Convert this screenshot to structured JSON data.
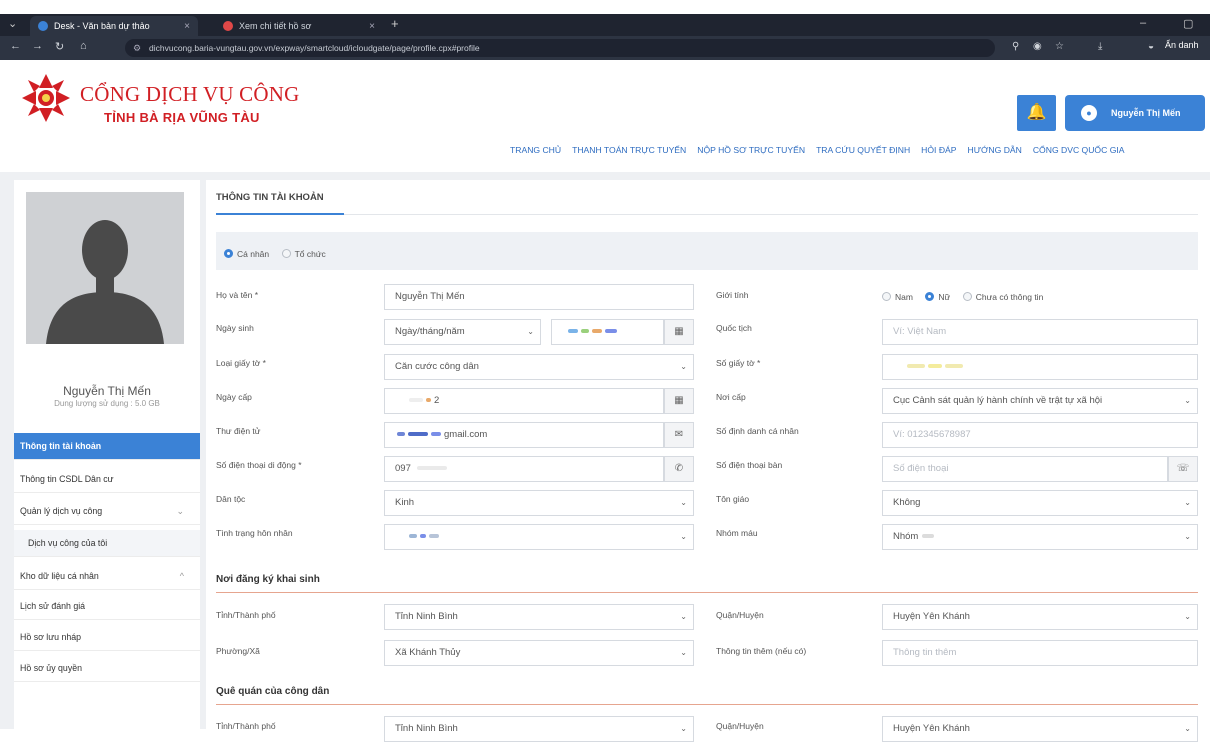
{
  "browser": {
    "tabs": [
      {
        "title": "Desk - Văn bản dự thảo",
        "color": "#3b82d6"
      },
      {
        "title": "Xem chi tiết hồ sơ",
        "color": "#e04848"
      }
    ],
    "new_tab": "+",
    "url": "dichvucong.baria-vungtau.gov.vn/expway/smartcloud/icloudgate/page/profile.cpx#profile",
    "incognito_label": "Ẩn danh"
  },
  "site": {
    "brand_line1": "CỔNG DỊCH VỤ CÔNG",
    "brand_line2": "TỈNH BÀ RỊA VŨNG TÀU",
    "user_name": "Nguyễn Thị Mến",
    "nav": [
      "TRANG CHỦ",
      "THANH TOÁN TRỰC TUYẾN",
      "NỘP HỒ SƠ TRỰC TUYẾN",
      "TRA CỨU QUYẾT ĐỊNH",
      "HỎI ĐÁP",
      "HƯỚNG DẪN",
      "CỔNG DVC QUỐC GIA"
    ]
  },
  "sidebar": {
    "user_name": "Nguyễn Thị Mến",
    "quota": "Dung lượng sử dụng : 5.0 GB",
    "items": [
      {
        "label": "Thông tin tài khoản",
        "active": true
      },
      {
        "label": "Thông tin CSDL Dân cư"
      },
      {
        "label": "Quản lý dịch vụ công",
        "caret": "⌄"
      },
      {
        "label": "Dịch vụ công của tôi",
        "sub": true
      },
      {
        "label": "Kho dữ liệu cá nhân",
        "caret": "^"
      },
      {
        "label": "Lịch sử đánh giá"
      },
      {
        "label": "Hồ sơ lưu nháp"
      },
      {
        "label": "Hồ sơ ủy quyền"
      }
    ]
  },
  "form": {
    "title": "THÔNG TIN TÀI KHOẢN",
    "account_type": {
      "options": [
        "Cá nhân",
        "Tổ chức"
      ],
      "selected": "Cá nhân"
    },
    "labels": {
      "full_name": "Họ và tên *",
      "dob": "Ngày sinh",
      "doc_type": "Loại giấy tờ *",
      "issue_date": "Ngày cấp",
      "email": "Thư điện tử",
      "mobile": "Số điện thoại di động *",
      "ethnicity": "Dân tộc",
      "marital": "Tình trạng hôn nhân",
      "gender": "Giới tính",
      "nationality": "Quốc tịch",
      "doc_no": "Số giấy tờ *",
      "issue_place": "Nơi cấp",
      "personal_id": "Số định danh cá nhân",
      "landline": "Số điện thoại bàn",
      "religion": "Tôn giáo",
      "blood": "Nhóm máu"
    },
    "values": {
      "full_name": "Nguyễn Thị Mến",
      "dob_format": "Ngày/tháng/năm",
      "doc_type": "Căn cước công dân",
      "issue_date_suffix": "2",
      "email_suffix": "gmail.com",
      "mobile_prefix": "097",
      "ethnicity": "Kinh",
      "issue_place": "Cục Cảnh sát quản lý hành chính về trật tự xã hội",
      "religion": "Không",
      "blood": "Nhóm"
    },
    "placeholders": {
      "nationality": "Ví: Việt Nam",
      "personal_id": "Ví: 012345678987",
      "landline": "Số điện thoại"
    },
    "gender": {
      "options": [
        "Nam",
        "Nữ",
        "Chưa có thông tin"
      ],
      "selected": "Nữ"
    },
    "birth_section": {
      "title": "Nơi đăng ký khai sinh",
      "province_label": "Tỉnh/Thành phố",
      "province": "Tỉnh Ninh Bình",
      "district_label": "Quận/Huyện",
      "district": "Huyện Yên Khánh",
      "ward_label": "Phường/Xã",
      "ward": "Xã Khánh Thủy",
      "extra_label": "Thông tin thêm (nếu có)",
      "extra_placeholder": "Thông tin thêm"
    },
    "hometown_section": {
      "title": "Quê quán của công dân",
      "province_label": "Tỉnh/Thành phố",
      "province": "Tỉnh Ninh Bình",
      "district_label": "Quận/Huyện",
      "district": "Huyện Yên Khánh"
    }
  },
  "colors": {
    "primary": "#3b82d6",
    "brand_red": "#d11f24",
    "section_rule": "#e6a58f"
  },
  "icons": {
    "calendar": "calendar-icon",
    "mail": "envelope-icon",
    "phone": "phone-icon",
    "landline": "landline-icon"
  }
}
